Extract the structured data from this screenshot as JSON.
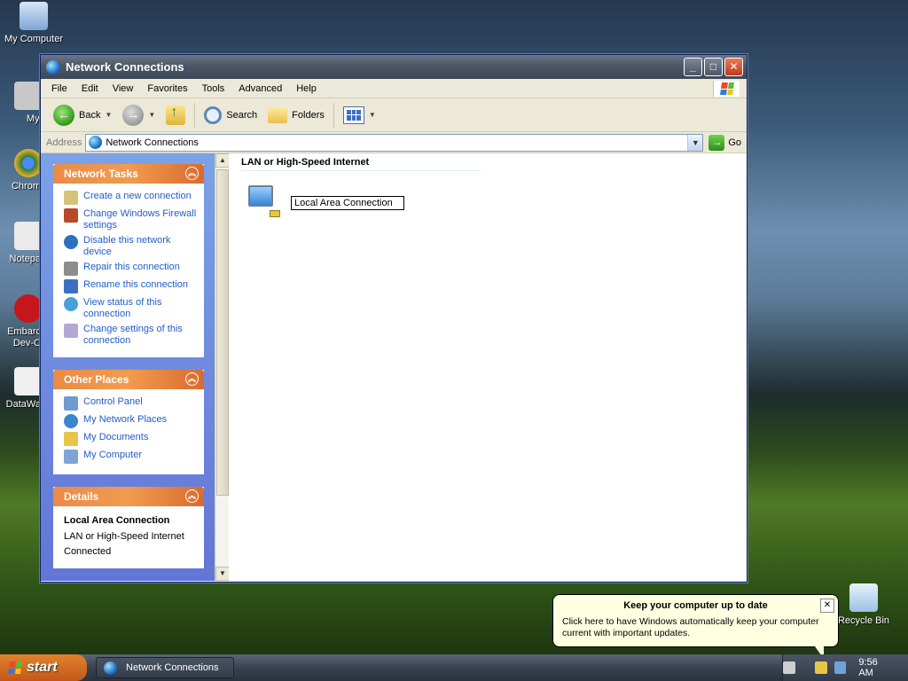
{
  "desktop": {
    "icons": [
      {
        "label": "My Computer"
      },
      {
        "label": "MyPa"
      },
      {
        "label": "Chrom"
      },
      {
        "label": "Notepa"
      },
      {
        "label": "Embarc Dev-C"
      },
      {
        "label": "DataWa"
      },
      {
        "label": "Recycle Bin"
      }
    ]
  },
  "window": {
    "title": "Network Connections",
    "buttons": {
      "minimize": "_",
      "maximize": "□",
      "close": "✕"
    }
  },
  "menu": [
    "File",
    "Edit",
    "View",
    "Favorites",
    "Tools",
    "Advanced",
    "Help"
  ],
  "toolbar": {
    "back": "Back",
    "search": "Search",
    "folders": "Folders"
  },
  "address": {
    "label": "Address",
    "value": "Network Connections",
    "go": "Go"
  },
  "tasks_panel": {
    "title": "Network Tasks",
    "items": [
      "Create a new connection",
      "Change Windows Firewall settings",
      "Disable this network device",
      "Repair this connection",
      "Rename this connection",
      "View status of this connection",
      "Change settings of this connection"
    ]
  },
  "places_panel": {
    "title": "Other Places",
    "items": [
      "Control Panel",
      "My Network Places",
      "My Documents",
      "My Computer"
    ]
  },
  "details_panel": {
    "title": "Details",
    "name": "Local Area Connection",
    "type": "LAN or High-Speed Internet",
    "status": "Connected"
  },
  "content": {
    "group": "LAN or High-Speed Internet",
    "connection_name": "Local Area Connection"
  },
  "balloon": {
    "title": "Keep your computer up to date",
    "text": "Click here to have Windows automatically keep your computer current with important updates."
  },
  "taskbar": {
    "start": "start",
    "task": "Network Connections",
    "clock": "9:56 AM"
  }
}
